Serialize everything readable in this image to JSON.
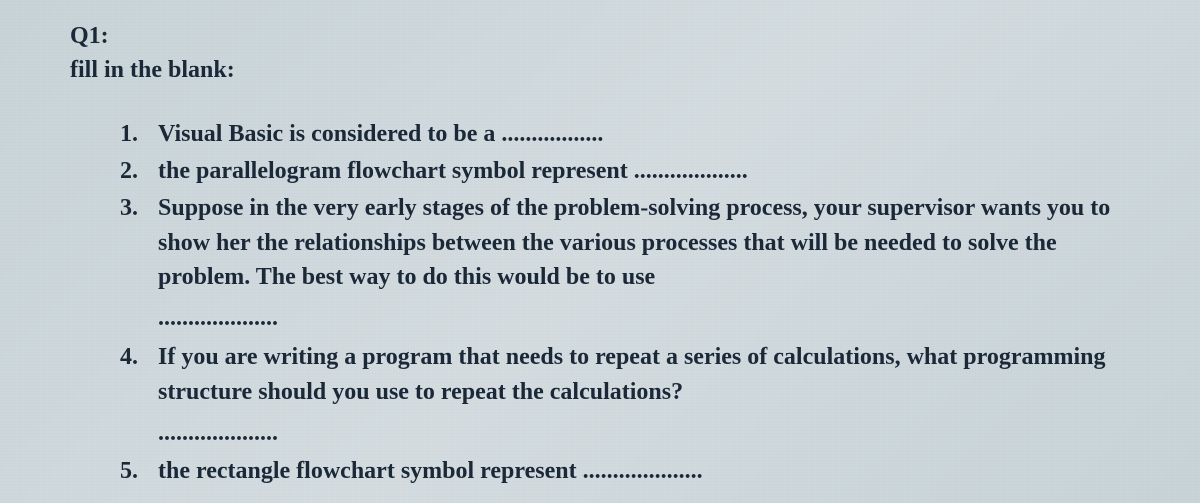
{
  "header": {
    "q_label": "Q1:",
    "instruction": "fill in the blank:"
  },
  "items": [
    {
      "text": "Visual Basic is considered to be a ................."
    },
    {
      "text": "the parallelogram flowchart symbol represent ..................."
    },
    {
      "text": "Suppose in the very early stages of the problem-solving process, your supervisor wants you to show her the relationships between the various processes that will be needed to solve the problem. The best way to do this would be to use",
      "blank": "...................."
    },
    {
      "text": "If you are writing a program that needs to repeat a series of calculations, what programming structure should you use to repeat the calculations?",
      "blank": "...................."
    },
    {
      "text": "the rectangle flowchart symbol represent ...................."
    }
  ]
}
